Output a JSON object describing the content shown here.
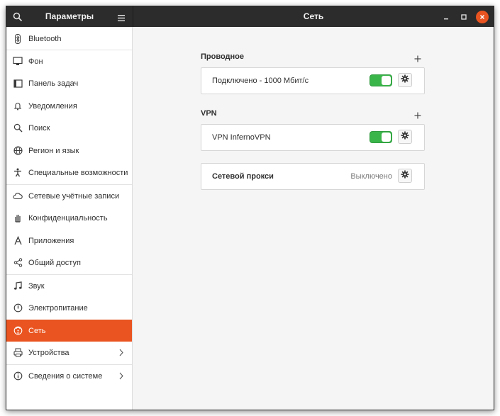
{
  "header": {
    "sidebar_title": "Параметры",
    "page_title": "Сеть"
  },
  "sidebar": {
    "items": [
      {
        "label": "Bluetooth",
        "icon": "bluetooth-icon"
      },
      {
        "label": "Фон",
        "icon": "background-icon"
      },
      {
        "label": "Панель задач",
        "icon": "dock-icon"
      },
      {
        "label": "Уведомления",
        "icon": "bell-icon"
      },
      {
        "label": "Поиск",
        "icon": "search-icon"
      },
      {
        "label": "Регион и язык",
        "icon": "globe-icon"
      },
      {
        "label": "Специальные возможности",
        "icon": "accessibility-icon"
      },
      {
        "label": "Сетевые учётные записи",
        "icon": "cloud-icon"
      },
      {
        "label": "Конфиденциальность",
        "icon": "hand-icon"
      },
      {
        "label": "Приложения",
        "icon": "apps-icon"
      },
      {
        "label": "Общий доступ",
        "icon": "share-icon"
      },
      {
        "label": "Звук",
        "icon": "music-note-icon"
      },
      {
        "label": "Электропитание",
        "icon": "power-icon"
      },
      {
        "label": "Сеть",
        "icon": "network-icon",
        "active": true
      },
      {
        "label": "Устройства",
        "icon": "printer-icon",
        "chevron": true
      },
      {
        "label": "Сведения о системе",
        "icon": "info-icon",
        "chevron": true
      }
    ]
  },
  "main": {
    "wired": {
      "title": "Проводное",
      "connection_label": "Подключено - 1000 Мбит/с",
      "enabled": true
    },
    "vpn": {
      "title": "VPN",
      "connection_label": "VPN InfernoVPN",
      "enabled": true
    },
    "proxy": {
      "label": "Сетевой прокси",
      "status": "Выключено"
    }
  },
  "colors": {
    "accent": "#e95420",
    "toggle_on": "#3ab54a",
    "headerbar": "#2c2c2c"
  }
}
